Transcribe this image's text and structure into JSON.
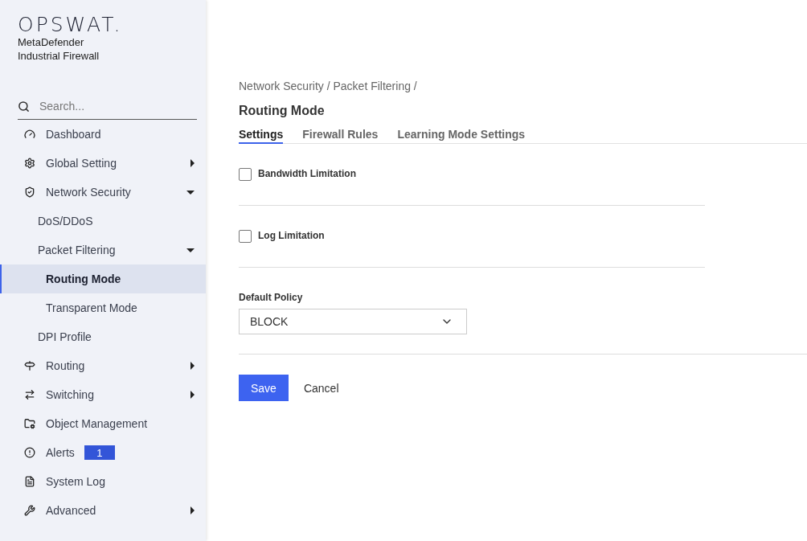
{
  "brand": {
    "logo": "OPSWAT.",
    "product_lines": [
      "MetaDefender",
      "Industrial Firewall"
    ]
  },
  "sidebar": {
    "search": {
      "placeholder": "Search..."
    },
    "items": [
      {
        "label": "Dashboard",
        "kind": "link",
        "selected": false
      },
      {
        "label": "Global Setting",
        "kind": "group",
        "expanded": false,
        "selected": false
      },
      {
        "label": "Network Security",
        "kind": "group",
        "expanded": true,
        "selected": false,
        "children": [
          {
            "label": "DoS/DDoS",
            "kind": "link",
            "selected": false
          },
          {
            "label": "Packet Filtering",
            "kind": "group",
            "expanded": true,
            "selected": false,
            "children": [
              {
                "label": "Routing Mode",
                "kind": "link",
                "selected": true
              },
              {
                "label": "Transparent Mode",
                "kind": "link",
                "selected": false
              }
            ]
          },
          {
            "label": "DPI Profile",
            "kind": "link",
            "selected": false
          }
        ]
      },
      {
        "label": "Routing",
        "kind": "group",
        "expanded": false,
        "selected": false
      },
      {
        "label": "Switching",
        "kind": "group",
        "expanded": false,
        "selected": false
      },
      {
        "label": "Object Management",
        "kind": "link",
        "selected": false
      },
      {
        "label": "Alerts",
        "kind": "link",
        "selected": false,
        "badge": "1"
      },
      {
        "label": "System Log",
        "kind": "link",
        "selected": false
      },
      {
        "label": "Advanced",
        "kind": "group",
        "expanded": false,
        "selected": false
      }
    ]
  },
  "breadcrumb": "Network Security / Packet Filtering /",
  "page_title": "Routing Mode",
  "tabs": [
    {
      "label": "Settings",
      "selected": true
    },
    {
      "label": "Firewall Rules",
      "selected": false
    },
    {
      "label": "Learning Mode Settings",
      "selected": false
    }
  ],
  "options": [
    {
      "label": "Bandwidth Limitation",
      "checked": false
    },
    {
      "label": "Log Limitation",
      "checked": false
    }
  ],
  "default_policy": {
    "label": "Default Policy",
    "value": "BLOCK"
  },
  "buttons": [
    {
      "label": "Save",
      "kind": "primary"
    },
    {
      "label": "Cancel",
      "kind": "plain"
    }
  ]
}
